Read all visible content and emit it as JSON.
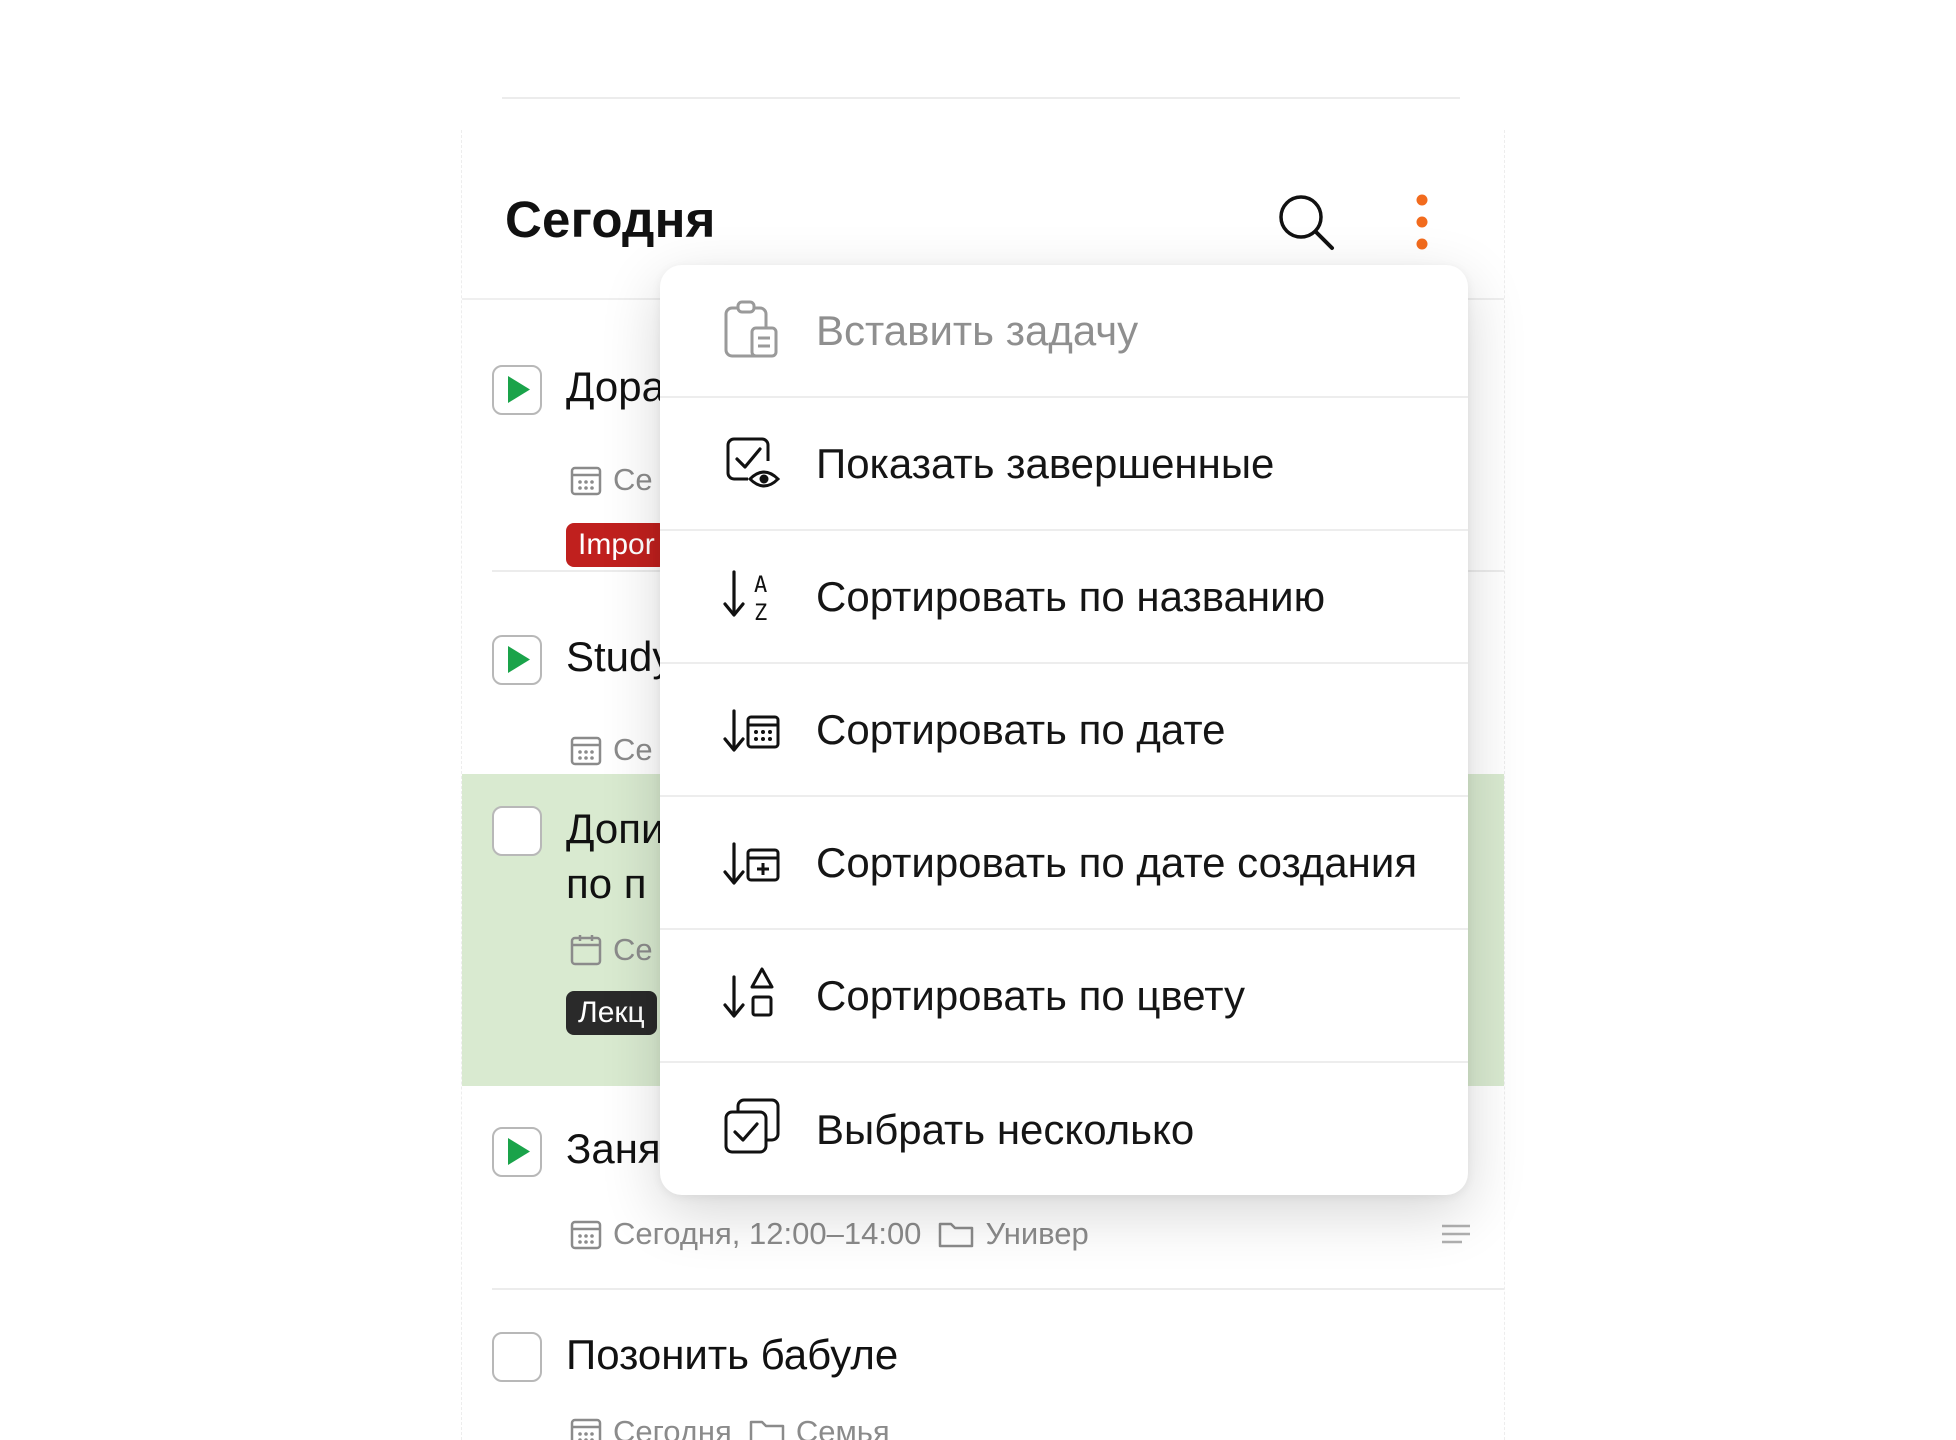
{
  "header": {
    "title": "Сегодня"
  },
  "tasks": [
    {
      "title": "Дора",
      "meta_date": "Се",
      "tag": "Impor",
      "colors": {
        "tag": "#c0201e"
      }
    },
    {
      "title": "Study",
      "meta_date": "Се"
    },
    {
      "title_line1": "Допи",
      "title_line2": "по п",
      "meta_date": "Се",
      "tag": "Лекц",
      "colors": {
        "background": "#d9ead0",
        "tag": "#2a2a2a"
      }
    },
    {
      "title": "Заня",
      "meta_date": "Сегодня, 12:00–14:00",
      "meta_folder": "Универ"
    },
    {
      "title": "Позонить бабуле",
      "meta_date": "Сегодня",
      "meta_folder": "Семья"
    }
  ],
  "menu": {
    "items": [
      {
        "label": "Вставить задачу",
        "icon": "clipboard-icon",
        "enabled": false
      },
      {
        "label": "Показать завершенные",
        "icon": "check-eye-icon",
        "enabled": true
      },
      {
        "label": "Сортировать по названию",
        "icon": "sort-az-icon",
        "enabled": true
      },
      {
        "label": "Сортировать по дате",
        "icon": "sort-date-icon",
        "enabled": true
      },
      {
        "label": "Сортировать по дате создания",
        "icon": "sort-created-icon",
        "enabled": true
      },
      {
        "label": "Сортировать по цвету",
        "icon": "sort-color-icon",
        "enabled": true
      },
      {
        "label": "Выбрать несколько",
        "icon": "multi-select-icon",
        "enabled": true
      }
    ]
  },
  "colors": {
    "accent": "#f26b1d",
    "play": "#1aa34a"
  }
}
